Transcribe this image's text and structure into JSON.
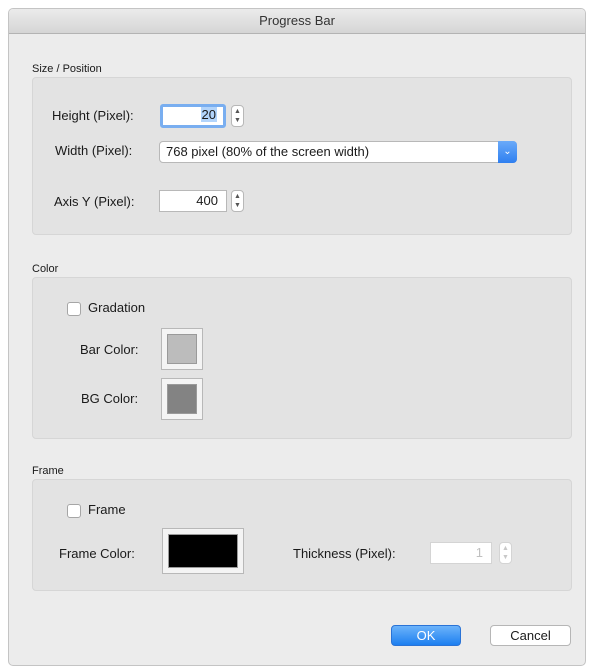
{
  "window": {
    "title": "Progress Bar"
  },
  "size_position": {
    "label": "Size / Position",
    "height_label": "Height (Pixel):",
    "height_value": "20",
    "width_label": "Width (Pixel):",
    "width_value": "768 pixel (80% of the screen width)",
    "axis_y_label": "Axis Y (Pixel):",
    "axis_y_value": "400"
  },
  "color": {
    "label": "Color",
    "gradation_label": "Gradation",
    "gradation_checked": false,
    "bar_color_label": "Bar Color:",
    "bar_color": "#bcbcbc",
    "bg_color_label": "BG Color:",
    "bg_color": "#838383"
  },
  "frame": {
    "label": "Frame",
    "frame_label": "Frame",
    "frame_checked": false,
    "frame_color_label": "Frame Color:",
    "frame_color": "#000000",
    "thickness_label": "Thickness (Pixel):",
    "thickness_value": "1"
  },
  "buttons": {
    "ok": "OK",
    "cancel": "Cancel"
  },
  "icons": {
    "stepper": "stepper-icon",
    "dropdown": "chevron-down-icon"
  },
  "colors": {
    "accent": "#2f7ff0",
    "focus_ring": "#79aef0"
  }
}
